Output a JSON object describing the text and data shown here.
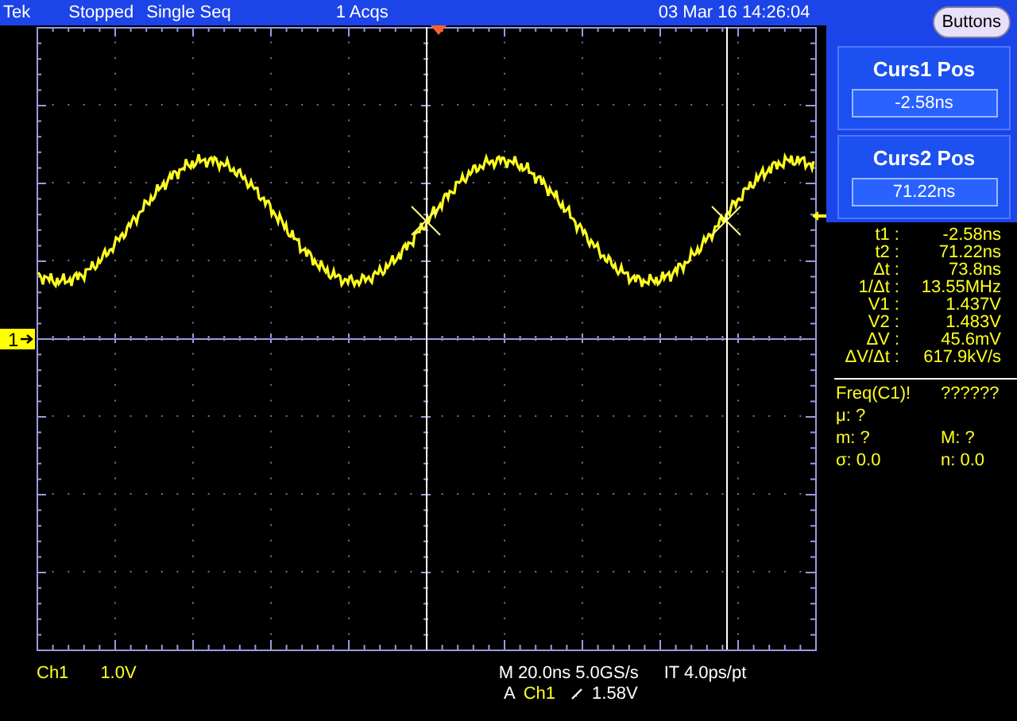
{
  "status_bar": {
    "brand": "Tek",
    "state": "Stopped",
    "mode": "Single Seq",
    "acquisitions": "1 Acqs",
    "datetime": "03 Mar 16 14:26:04"
  },
  "menu_button": "Buttons",
  "cursor_panels": [
    {
      "title": "Curs1 Pos",
      "value": "-2.58ns"
    },
    {
      "title": "Curs2 Pos",
      "value": "71.22ns"
    }
  ],
  "cursor_readouts": [
    {
      "label": "t1 :",
      "value": "-2.58ns"
    },
    {
      "label": "t2 :",
      "value": "71.22ns"
    },
    {
      "label": "Δt :",
      "value": "73.8ns"
    },
    {
      "label": "1/Δt :",
      "value": "13.55MHz"
    },
    {
      "label": "V1 :",
      "value": "1.437V"
    },
    {
      "label": "V2 :",
      "value": "1.483V"
    },
    {
      "label": "ΔV :",
      "value": "45.6mV"
    },
    {
      "label": "ΔV/Δt :",
      "value": "617.9kV/s"
    }
  ],
  "measurement": {
    "name": "Freq(C1)!",
    "value": "??????",
    "stats": [
      {
        "label": "μ:",
        "value": "?"
      },
      {
        "label": "m:",
        "value": "?"
      },
      {
        "label": "M:",
        "value": "?"
      },
      {
        "label": "σ:",
        "value": "0.0"
      },
      {
        "label": "n:",
        "value": "0.0"
      }
    ]
  },
  "channel_marker": "1",
  "footer": {
    "channel": "Ch1",
    "scale": "1.0V",
    "timebase": "M 20.0ns 5.0GS/s",
    "interpolation": "IT 4.0ps/pt",
    "trigger_mode": "A",
    "trigger_source": "Ch1",
    "trigger_level": "1.58V"
  }
}
